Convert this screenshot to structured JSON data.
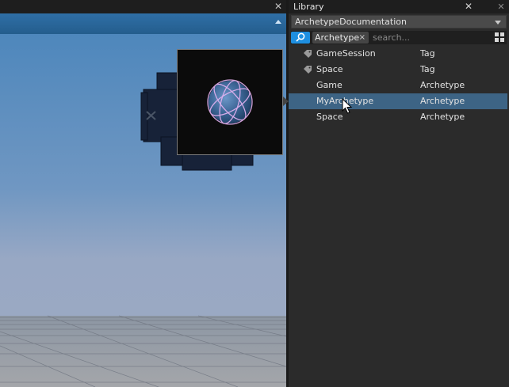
{
  "viewport": {
    "close_glyph": "✕",
    "collapse_icon": "triangle-up-icon",
    "sky_top": "#4f88bd",
    "sky_bottom": "#9aaec8",
    "floor_color": "#9a9a9a",
    "preview_bg": "#0b0b0b"
  },
  "library": {
    "title": "Library",
    "close_glyph": "✕",
    "close2_glyph": "✕",
    "dropdown_value": "ArchetypeDocumentation",
    "search": {
      "icon": "magnifier-icon",
      "tag_label": "Archetype",
      "tag_remove": "×",
      "placeholder": "search...",
      "value": ""
    },
    "view_toggle_icon": "grid-view-icon",
    "items": [
      {
        "name": "GameSession",
        "type": "Tag",
        "icon": "tag-icon",
        "selected": false
      },
      {
        "name": "Space",
        "type": "Tag",
        "icon": "tag-icon",
        "selected": false
      },
      {
        "name": "Game",
        "type": "Archetype",
        "icon": "",
        "selected": false
      },
      {
        "name": "MyArchetype",
        "type": "Archetype",
        "icon": "",
        "selected": true
      },
      {
        "name": "Space",
        "type": "Archetype",
        "icon": "",
        "selected": false
      }
    ],
    "accent": "#1e8fe0",
    "selection": "#3d6485"
  }
}
